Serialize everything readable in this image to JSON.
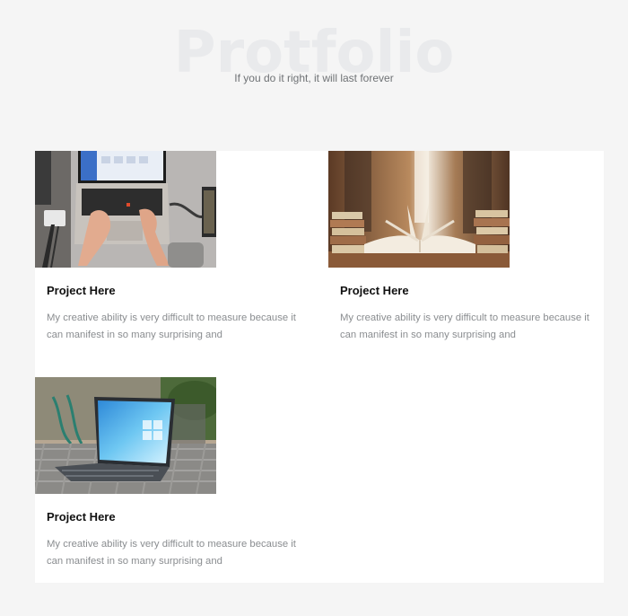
{
  "hero": {
    "watermark": "Protfolio",
    "tagline": "If you do it right, it will last forever"
  },
  "projects": [
    {
      "title": "Project Here",
      "description": "My creative ability is very difficult to measure because it can manifest in so many surprising and",
      "image": "laptop-typing-photo"
    },
    {
      "title": "Project Here",
      "description": "My creative ability is very difficult to measure because it can manifest in so many surprising and",
      "image": "library-books-photo"
    },
    {
      "title": "Project Here",
      "description": "My creative ability is very difficult to measure because it can manifest in so many surprising and",
      "image": "laptop-outdoor-photo"
    }
  ]
}
